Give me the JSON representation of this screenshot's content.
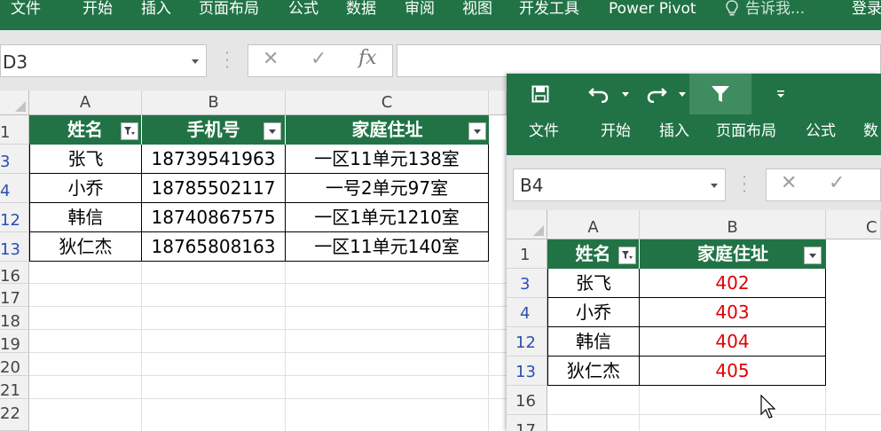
{
  "main": {
    "ribbon_tabs": [
      "文件",
      "开始",
      "插入",
      "页面布局",
      "公式",
      "数据",
      "审阅",
      "视图",
      "开发工具",
      "Power Pivot"
    ],
    "tell_me": "告诉我...",
    "login": "登录",
    "name_box": "D3",
    "columns": [
      "A",
      "B",
      "C"
    ],
    "row_numbers": [
      "1",
      "3",
      "4",
      "12",
      "13",
      "16",
      "17",
      "18",
      "19",
      "20",
      "21",
      "22"
    ],
    "table": {
      "headers": [
        "姓名",
        "手机号",
        "家庭住址"
      ],
      "rows": [
        [
          "张飞",
          "18739541963",
          "一区11单元138室"
        ],
        [
          "小乔",
          "18785502117",
          "一号2单元97室"
        ],
        [
          "韩信",
          "18740867575",
          "一区1单元1210室"
        ],
        [
          "狄仁杰",
          "18765808163",
          "一区11单元140室"
        ]
      ]
    }
  },
  "second_window": {
    "ribbon_tabs": [
      "文件",
      "开始",
      "插入",
      "页面布局",
      "公式",
      "数"
    ],
    "name_box": "B4",
    "columns": [
      "A",
      "B",
      "C"
    ],
    "row_numbers": [
      "1",
      "3",
      "4",
      "12",
      "13",
      "16",
      "17"
    ],
    "table": {
      "headers": [
        "姓名",
        "家庭住址"
      ],
      "rows": [
        [
          "张飞",
          "402"
        ],
        [
          "小乔",
          "403"
        ],
        [
          "韩信",
          "404"
        ],
        [
          "狄仁杰",
          "405"
        ]
      ]
    }
  },
  "colors": {
    "ribbon_green": "#217346",
    "value_red": "#e00000",
    "filtered_row": "#2b4fb0"
  }
}
